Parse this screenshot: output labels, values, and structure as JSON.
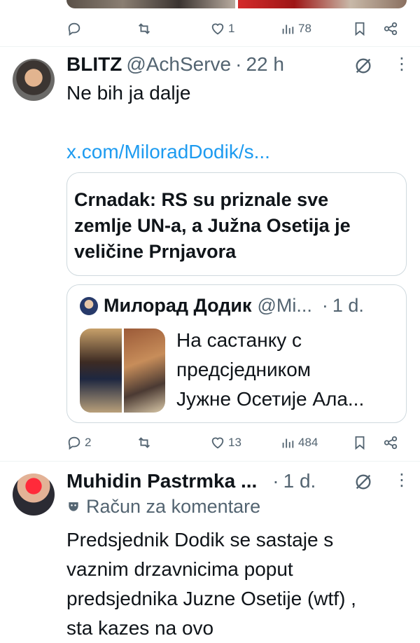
{
  "tweet0": {
    "actions": {
      "replies": "",
      "retweets": "",
      "likes": "1",
      "views": "78"
    }
  },
  "tweet1": {
    "name": "BLITZ",
    "handle": "@AchServe",
    "separator": "·",
    "time": "22 h",
    "text_line1": "Ne bih ja dalje",
    "link": "x.com/MiloradDodik/s...",
    "card": {
      "title_line1": "Crnadak: RS su priznale sve",
      "title_line2": "zemlje UN-a, a Južna Osetija je",
      "title_line3": "veličine Prnjavora"
    },
    "quote": {
      "name": "Милорад Додик",
      "handle": "@Mi...",
      "separator": "·",
      "time": "1 d.",
      "text_line1": "На састанку с",
      "text_line2": "предсједником",
      "text_line3": "Јужне Осетије Ала..."
    },
    "actions": {
      "replies": "2",
      "retweets": "",
      "likes": "13",
      "views": "484"
    }
  },
  "tweet2": {
    "name": "Muhidin Pastrmka ...",
    "separator": "·",
    "time": "1 d.",
    "account_label": "Račun za komentare",
    "text_line1": "Predsjednik Dodik se sastaje s",
    "text_line2": "vaznim drzavnicima poput",
    "text_line3": "predsjednika Juzne Osetije (wtf) ,",
    "text_line4": "sta kazes na ovo"
  },
  "colors": {
    "text": "#0f1419",
    "secondary": "#536471",
    "link": "#1d9bf0",
    "border": "#cfd9de"
  }
}
